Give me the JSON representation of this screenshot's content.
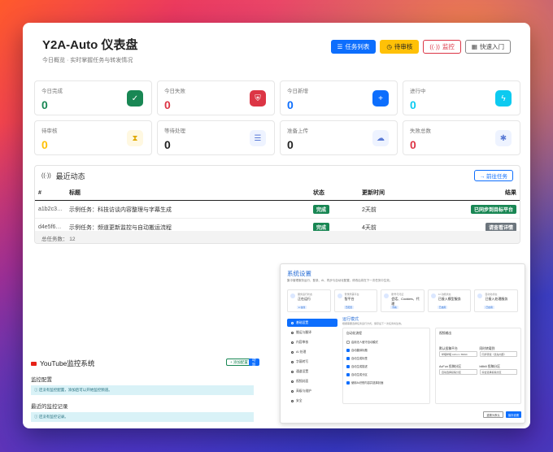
{
  "header": {
    "title": "Y2A-Auto 仪表盘",
    "subtitle": "今日概览 · 实时掌握任务与转发情况",
    "buttons": [
      "任务列表",
      "待审核",
      "监控",
      "快速入门"
    ]
  },
  "stats": [
    {
      "label": "今日完成",
      "value": "0",
      "color": "#198754",
      "icon": "check-icon"
    },
    {
      "label": "今日失败",
      "value": "0",
      "color": "#dc3545",
      "icon": "shield-icon"
    },
    {
      "label": "今日新增",
      "value": "0",
      "color": "#0d6efd",
      "icon": "plus-icon"
    },
    {
      "label": "进行中",
      "value": "0",
      "color": "#0dcaf0",
      "icon": "bolt-icon"
    },
    {
      "label": "待审核",
      "value": "0",
      "color": "#ffc107",
      "icon": "hourglass-icon"
    },
    {
      "label": "等待处理",
      "value": "0",
      "color": "#222222",
      "icon": "list-icon"
    },
    {
      "label": "准备上传",
      "value": "0",
      "color": "#222222",
      "icon": "cloud-upload-icon"
    },
    {
      "label": "失败总数",
      "value": "0",
      "color": "#dc3545",
      "icon": "bug-icon"
    }
  ],
  "recent": {
    "title": "最近动态",
    "button": "→ 前往任务",
    "columns": [
      "#",
      "标题",
      "状态",
      "更新时间",
      "结果"
    ],
    "rows": [
      {
        "id": "a1b2c3…",
        "title": "示例任务：科技访谈内容整理与字幕生成",
        "status": "完成",
        "time": "2天前",
        "result": "已同步到目标平台",
        "result_color": "#198754"
      },
      {
        "id": "d4e5f6…",
        "title": "示例任务：频道更新监控与自动搬运流程",
        "status": "完成",
        "time": "4天前",
        "result": "请查看详情",
        "result_color": "#6c757d"
      }
    ],
    "footer": "总任务数：  12"
  },
  "youtube": {
    "title": "YouTube监控系统",
    "btn_a": "+ 添加配置",
    "btn_b": "手动监控",
    "section1": "监控配置",
    "info1": "ⓘ 还没有监控配置，添加后可以开始监控频道。",
    "section2": "最近的监控记录",
    "info2": "ⓘ 还没有监控记录。"
  },
  "settings": {
    "title": "系统设置",
    "subtitle": "集中管理服务运行、登录、AI、同步与自动化配置，修改后将在下一次任务中生效。",
    "cards": [
      {
        "k": "服务运行状态",
        "v": "正在运行",
        "tag": "● 在线"
      },
      {
        "k": "登录所需平台",
        "v": "智平台",
        "tag": "已配置"
      },
      {
        "k": "账号与凭证",
        "v": "会话、Cookies、代理",
        "tag": "查看"
      },
      {
        "k": "AI 功能状态",
        "v": "已接入模型服务",
        "tag": "已启用"
      },
      {
        "k": "自动化状态",
        "v": "已接入处理服务",
        "tag": "已启用"
      }
    ],
    "nav": [
      "基础设置",
      "搬运与翻译",
      "内容审核",
      "AI 处理",
      "字幕转写",
      "通道设置",
      "视频封面",
      "高级与维护",
      "安全"
    ],
    "main_title": "运行模式",
    "main_sub": "根据需要选择任务运行方式，保存后下一次任务将生效。",
    "panel1_title": "自动化流程",
    "checks": [
      "启用无人值守自动模式",
      "自动翻译标题",
      "自动生成标签",
      "自动生成描述",
      "自动生成分区",
      "使用AI识别内容并选择封面"
    ],
    "panel2_title": "视频输出",
    "field1": "默认投稿平台",
    "field2": "同时转载到",
    "field3": "AcFun 投稿分区",
    "field4": "bilibili 投稿分区",
    "sel1": "哔哩哔哩 AcFun / Bilibili",
    "sel2": "同步转载（优先内部）",
    "sel3": "自动选择投稿分区",
    "sel4": "综合选择投稿分区",
    "btn_reset": "重置为默认",
    "btn_save": "保存设置"
  }
}
